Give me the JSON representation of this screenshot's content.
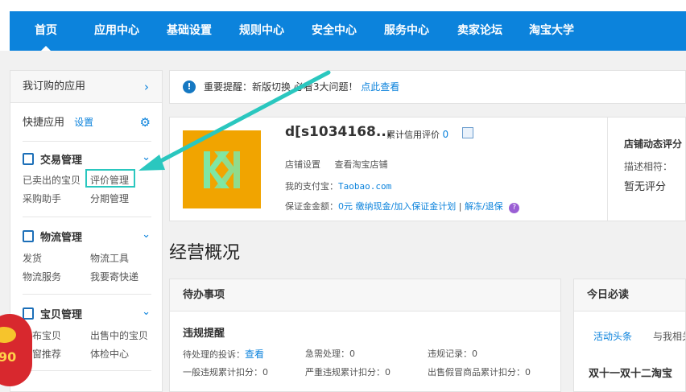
{
  "nav": {
    "items": [
      "首页",
      "应用中心",
      "基础设置",
      "规则中心",
      "安全中心",
      "服务中心",
      "卖家论坛",
      "淘宝大学"
    ]
  },
  "sidebar": {
    "my_apps": "我订购的应用",
    "quick_apps": "快捷应用",
    "quick_settings": "设置",
    "sections": [
      {
        "title": "交易管理",
        "links": [
          "已卖出的宝贝",
          "评价管理",
          "采购助手",
          "分期管理"
        ]
      },
      {
        "title": "物流管理",
        "links": [
          "发货",
          "物流工具",
          "物流服务",
          "我要寄快递"
        ]
      },
      {
        "title": "宝贝管理",
        "links": [
          "发布宝贝",
          "出售中的宝贝",
          "橱窗推荐",
          "体检中心"
        ]
      }
    ]
  },
  "notice": {
    "text": "重要提醒：新版切换 必看3大问题！",
    "link": "点此查看"
  },
  "shop": {
    "name": "d[s1034168...",
    "credit_label": "累计信用评价",
    "credit_value": "0",
    "settings": "店铺设置",
    "view_shop": "查看淘宝店铺",
    "alipay_label": "我的支付宝：",
    "alipay_value": "Taobao.com",
    "deposit_label": "保证金金额：",
    "deposit_value": "0元",
    "deposit_link": "缴纳现金/加入保证金计划",
    "sep": "|",
    "refund_link": "解冻/退保",
    "help": "?",
    "dynamic_title": "店铺动态评分",
    "dynamic_label": "描述相符：",
    "dynamic_value": "暂无评分"
  },
  "overview": {
    "title": "经营概况"
  },
  "todo": {
    "title": "待办事项",
    "subtitle": "违规提醒",
    "complaint_label": "待处理的投诉：",
    "complaint_link": "查看",
    "urgent": "急需处理：0",
    "violation": "违规记录：0",
    "general": "一般违规累计扣分：0",
    "serious": "严重违规累计扣分：0",
    "fake": "出售假冒商品累计扣分：0"
  },
  "read": {
    "title": "今日必读",
    "tab_active": "活动头条",
    "tab_other": "与我相关",
    "headline": "双十一双十二淘宝"
  },
  "promo": {
    "text": "90"
  },
  "colors": {
    "brand": "#0c83dc",
    "annotation": "#2ac7bf",
    "logo_bg": "#f1a400",
    "logo_fg": "#7fe6a4"
  }
}
